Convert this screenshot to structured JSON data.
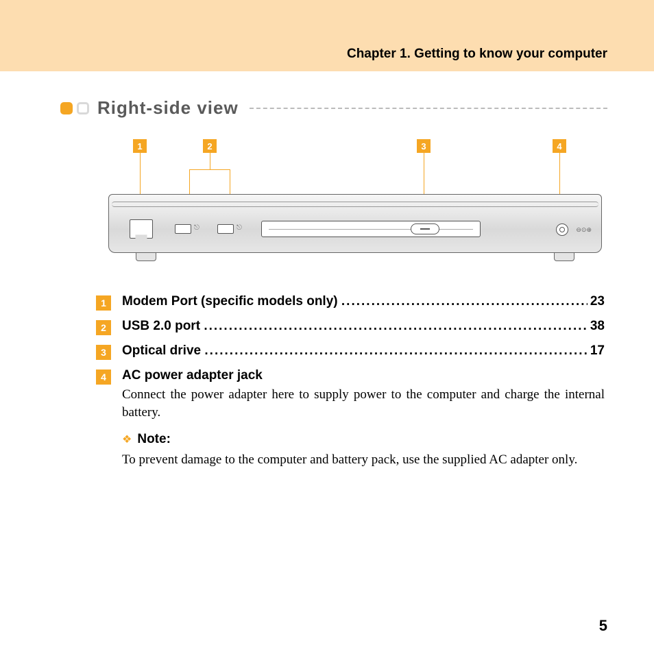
{
  "chapter_title": "Chapter 1. Getting to know your computer",
  "section_title": "Right-side view",
  "callouts": [
    "1",
    "2",
    "3",
    "4"
  ],
  "items": [
    {
      "num": "1",
      "label": "Modem Port (specific models only)",
      "page": "23"
    },
    {
      "num": "2",
      "label": "USB 2.0 port",
      "page": "38"
    },
    {
      "num": "3",
      "label": "Optical drive",
      "page": "17"
    },
    {
      "num": "4",
      "label": "AC power adapter jack",
      "desc": "Connect the power adapter here to supply power to the computer and charge the internal battery.",
      "note_label": "Note:",
      "note_text": "To prevent damage to the computer and battery pack, use the supplied AC adapter only."
    }
  ],
  "page_number": "5"
}
